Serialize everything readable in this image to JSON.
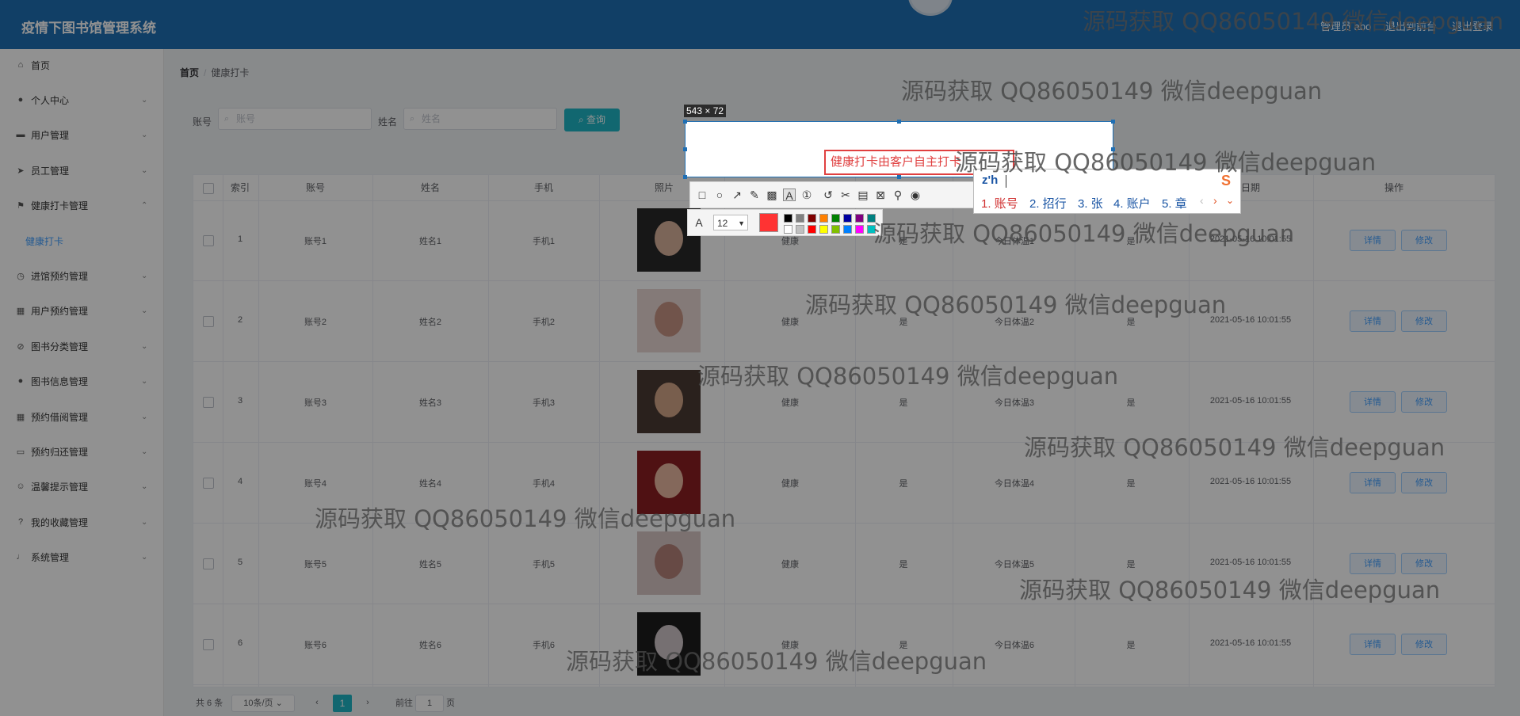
{
  "app": {
    "title": "疫情下图书馆管理系统",
    "header_items": [
      "管理员 abo",
      "退出到前台",
      "退出登录"
    ]
  },
  "sidebar": {
    "items": [
      {
        "icon": "home-icon",
        "glyph": "⌂",
        "label": "首页",
        "chevron": ""
      },
      {
        "icon": "user-icon",
        "glyph": "●",
        "label": "个人中心",
        "chevron": "⌄"
      },
      {
        "icon": "id-card-icon",
        "glyph": "▬",
        "label": "用户管理",
        "chevron": "⌄"
      },
      {
        "icon": "send-icon",
        "glyph": "➤",
        "label": "员工管理",
        "chevron": "⌄"
      },
      {
        "icon": "flag-icon",
        "glyph": "⚑",
        "label": "健康打卡管理",
        "chevron": "⌃"
      },
      {
        "icon": "",
        "glyph": "",
        "label": "健康打卡",
        "chevron": ""
      },
      {
        "icon": "clock-icon",
        "glyph": "◷",
        "label": "进馆预约管理",
        "chevron": "⌄"
      },
      {
        "icon": "grid-icon",
        "glyph": "▦",
        "label": "用户预约管理",
        "chevron": "⌄"
      },
      {
        "icon": "compass-icon",
        "glyph": "⊘",
        "label": "图书分类管理",
        "chevron": "⌄"
      },
      {
        "icon": "user-icon",
        "glyph": "●",
        "label": "图书信息管理",
        "chevron": "⌄"
      },
      {
        "icon": "apps-icon",
        "glyph": "▦",
        "label": "预约借阅管理",
        "chevron": "⌄"
      },
      {
        "icon": "comment-icon",
        "glyph": "▭",
        "label": "预约归还管理",
        "chevron": "⌄"
      },
      {
        "icon": "smile-icon",
        "glyph": "☺",
        "label": "温馨提示管理",
        "chevron": "⌄"
      },
      {
        "icon": "help-icon",
        "glyph": "?",
        "label": "我的收藏管理",
        "chevron": "⌄"
      },
      {
        "icon": "mic-icon",
        "glyph": "♩",
        "label": "系统管理",
        "chevron": "⌄"
      }
    ]
  },
  "breadcrumb": {
    "home": "首页",
    "sep": "/",
    "current": "健康打卡"
  },
  "search": {
    "account_label": "账号",
    "account_placeholder": "账号",
    "name_label": "姓名",
    "name_placeholder": "姓名",
    "query_button": "查询",
    "search_glyph": "⌕"
  },
  "table": {
    "columns": [
      "索引",
      "账号",
      "姓名",
      "手机",
      "照片",
      "",
      "",
      "",
      "",
      "日期",
      "操作"
    ],
    "detail_label": "详情",
    "edit_label": "修改",
    "rows": [
      {
        "index": "1",
        "account": "账号1",
        "name": "姓名1",
        "phone": "手机1",
        "status": "健康",
        "flag": "是",
        "temp": "今日体温1",
        "confirm": "是",
        "date": "2021-05-16 10:01:55"
      },
      {
        "index": "2",
        "account": "账号2",
        "name": "姓名2",
        "phone": "手机2",
        "status": "健康",
        "flag": "是",
        "temp": "今日体温2",
        "confirm": "是",
        "date": "2021-05-16 10:01:55"
      },
      {
        "index": "3",
        "account": "账号3",
        "name": "姓名3",
        "phone": "手机3",
        "status": "健康",
        "flag": "是",
        "temp": "今日体温3",
        "confirm": "是",
        "date": "2021-05-16 10:01:55"
      },
      {
        "index": "4",
        "account": "账号4",
        "name": "姓名4",
        "phone": "手机4",
        "status": "健康",
        "flag": "是",
        "temp": "今日体温4",
        "confirm": "是",
        "date": "2021-05-16 10:01:55"
      },
      {
        "index": "5",
        "account": "账号5",
        "name": "姓名5",
        "phone": "手机5",
        "status": "健康",
        "flag": "是",
        "temp": "今日体温5",
        "confirm": "是",
        "date": "2021-05-16 10:01:55"
      },
      {
        "index": "6",
        "account": "账号6",
        "name": "姓名6",
        "phone": "手机6",
        "status": "健康",
        "flag": "是",
        "temp": "今日体温6",
        "confirm": "是",
        "date": "2021-05-16 10:01:55"
      }
    ]
  },
  "pagination": {
    "total": "共 6 条",
    "page_size": "10条/页",
    "current": "1",
    "goto_prefix": "前往",
    "goto_value": "1",
    "goto_suffix": "页",
    "prev": "‹",
    "next": "›"
  },
  "screenshot_tool": {
    "size_badge": "543 × 72",
    "text_content": "健康打卡由客户自主打卡",
    "font_size": "12",
    "current_color": "#ff3333"
  },
  "ime": {
    "input": "z'h",
    "candidates": [
      "1. 账号",
      "2. 招行",
      "3. 张",
      "4. 账户",
      "5. 章"
    ]
  },
  "watermark": "源码获取 QQ86050149 微信deepguan",
  "colors": {
    "header": "#1f6fb4",
    "accent": "#1fb6c5",
    "link": "#409eff"
  }
}
